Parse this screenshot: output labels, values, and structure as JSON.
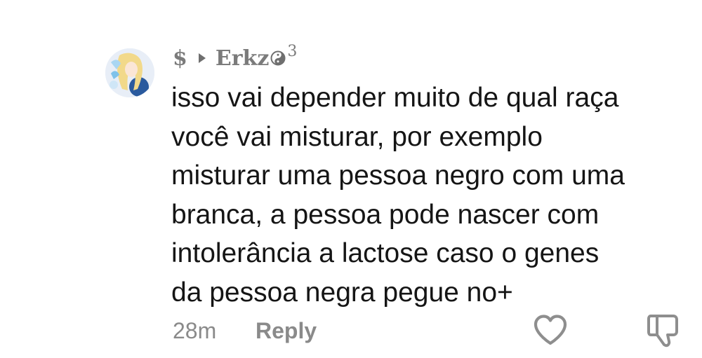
{
  "comment": {
    "username": {
      "prefix": "$",
      "name": "Erkz",
      "symbol_icon": "yin-yang-icon",
      "superscript": "3"
    },
    "text_lines": [
      "isso vai depender muito de qual raça",
      "você vai misturar, por exemplo",
      "misturar uma pessoa negro com uma",
      "branca, a pessoa pode nascer com",
      "intolerância a lactose caso o genes",
      "da pessoa negra pegue no+"
    ],
    "timestamp": "28m",
    "reply_label": "Reply",
    "icons": {
      "like": "heart-outline-icon",
      "dislike": "thumbs-down-outline-icon",
      "triangle": "play-triangle-icon",
      "avatar": "anime-avatar-image"
    }
  }
}
